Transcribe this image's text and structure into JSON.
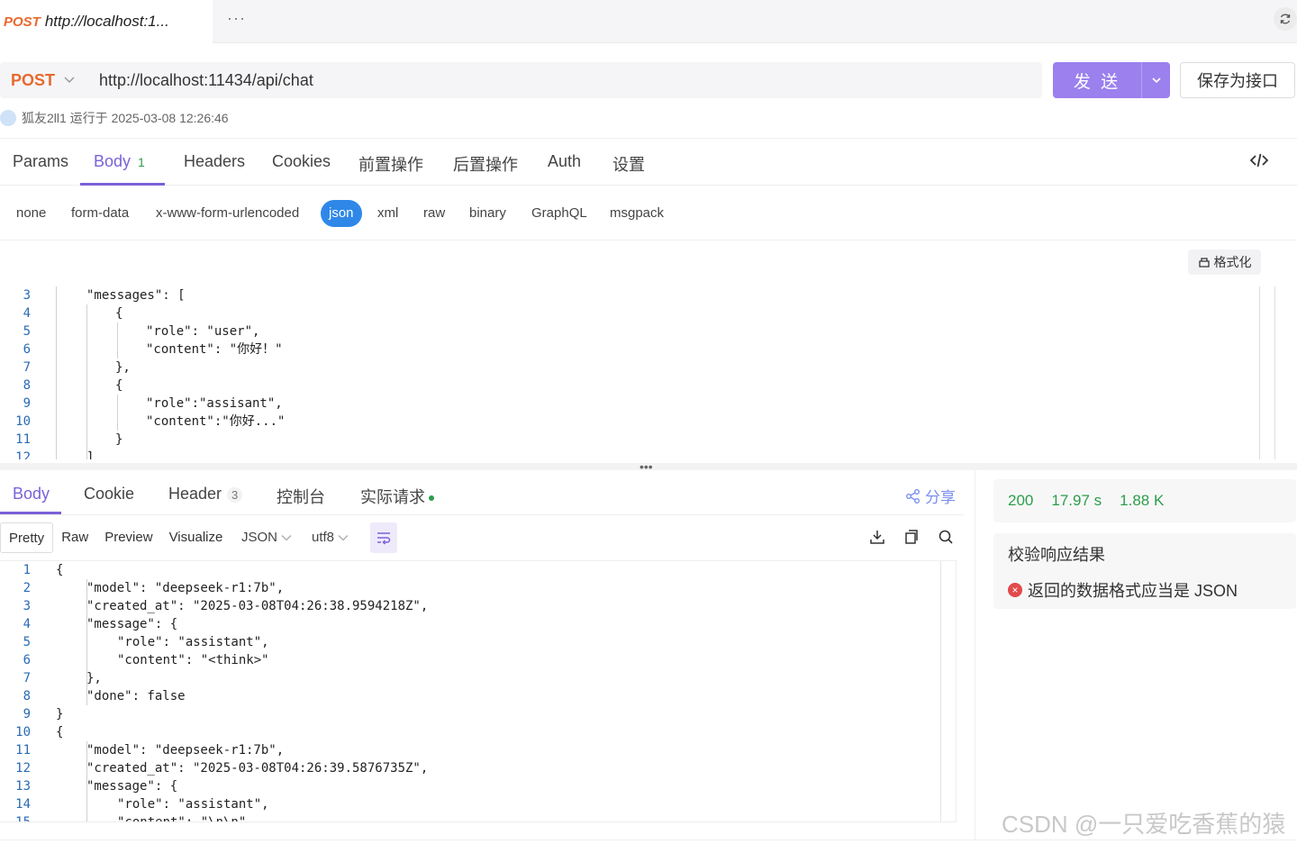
{
  "doc_tab": {
    "method": "POST",
    "url": "http://localhost:1..."
  },
  "tabbar": {
    "more": "···"
  },
  "request": {
    "method": "POST",
    "url": "http://localhost:11434/api/chat",
    "send_label": "发 送",
    "save_label": "保存为接口",
    "run_info": "狐友2ll1 运行于 2025-03-08 12:26:46"
  },
  "req_tabs": [
    {
      "label": "Params"
    },
    {
      "label": "Body",
      "badge": "1"
    },
    {
      "label": "Headers"
    },
    {
      "label": "Cookies"
    },
    {
      "label": "前置操作"
    },
    {
      "label": "后置操作"
    },
    {
      "label": "Auth"
    },
    {
      "label": "设置"
    }
  ],
  "body_types": [
    "none",
    "form-data",
    "x-www-form-urlencoded",
    "json",
    "xml",
    "raw",
    "binary",
    "GraphQL",
    "msgpack"
  ],
  "format_label": "格式化",
  "request_body": [
    {
      "n": "3",
      "t": "\"messages\": ["
    },
    {
      "n": "4",
      "t": "{"
    },
    {
      "n": "5",
      "t": "\"role\": \"user\","
    },
    {
      "n": "6",
      "t": "\"content\": \"你好！\""
    },
    {
      "n": "7",
      "t": "},"
    },
    {
      "n": "8",
      "t": "{"
    },
    {
      "n": "9",
      "t": "\"role\":\"assisant\","
    },
    {
      "n": "10",
      "t": "\"content\":\"你好...\""
    },
    {
      "n": "11",
      "t": "}"
    },
    {
      "n": "12",
      "t": "]"
    }
  ],
  "split_handle": "•••",
  "resp_tabs": [
    {
      "label": "Body"
    },
    {
      "label": "Cookie"
    },
    {
      "label": "Header",
      "badge": "3"
    },
    {
      "label": "控制台"
    },
    {
      "label": "实际请求"
    }
  ],
  "share_label": "分享",
  "view_modes": [
    "Pretty",
    "Raw",
    "Preview",
    "Visualize"
  ],
  "format_select": "JSON",
  "encoding_select": "utf8",
  "response_body": [
    {
      "n": "1",
      "t": "{"
    },
    {
      "n": "2",
      "t": "\"model\": \"deepseek-r1:7b\","
    },
    {
      "n": "3",
      "t": "\"created_at\": \"2025-03-08T04:26:38.9594218Z\","
    },
    {
      "n": "4",
      "t": "\"message\": {"
    },
    {
      "n": "5",
      "t": "\"role\": \"assistant\","
    },
    {
      "n": "6",
      "t": "\"content\": \"<think>\""
    },
    {
      "n": "7",
      "t": "},"
    },
    {
      "n": "8",
      "t": "\"done\": false"
    },
    {
      "n": "9",
      "t": "}"
    },
    {
      "n": "10",
      "t": "{"
    },
    {
      "n": "11",
      "t": "\"model\": \"deepseek-r1:7b\","
    },
    {
      "n": "12",
      "t": "\"created_at\": \"2025-03-08T04:26:39.5876735Z\","
    },
    {
      "n": "13",
      "t": "\"message\": {"
    },
    {
      "n": "14",
      "t": "\"role\": \"assistant\","
    },
    {
      "n": "15",
      "t": "\"content\": \"\\n\\n\","
    }
  ],
  "stats": {
    "status": "200",
    "time": "17.97 s",
    "size": "1.88 K"
  },
  "validation": {
    "title": "校验响应结果",
    "error": "返回的数据格式应当是 JSON"
  },
  "watermark": "CSDN @一只爱吃香蕉的猿",
  "colors": {
    "accent": "#7b61d8",
    "send": "#9b80ee",
    "method": "#e8692d",
    "success": "#2c9e4a",
    "json_pill": "#2f88e8",
    "error": "#e24a4a"
  }
}
